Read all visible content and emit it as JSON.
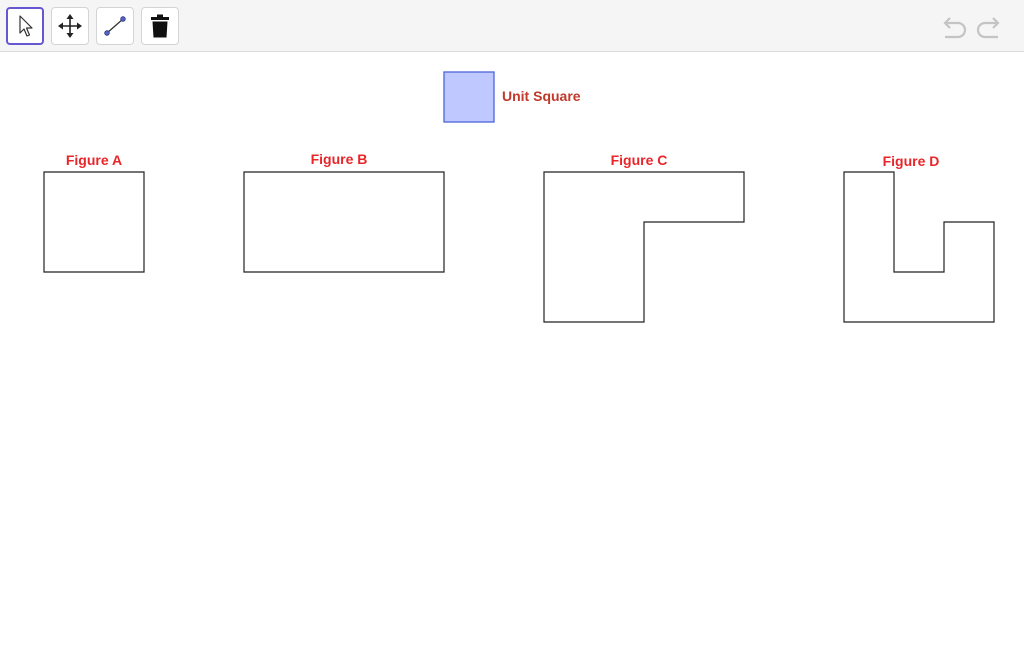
{
  "toolbar": {
    "tools": [
      {
        "name": "move-tool",
        "icon": "arrow-cursor-icon",
        "selected": true
      },
      {
        "name": "move-graphics-view-tool",
        "icon": "four-way-arrows-icon",
        "selected": false
      },
      {
        "name": "segment-tool",
        "icon": "segment-icon",
        "selected": false
      },
      {
        "name": "delete-tool",
        "icon": "trash-icon",
        "selected": false
      }
    ],
    "undo_icon": "undo-icon",
    "redo_icon": "redo-icon"
  },
  "canvas": {
    "unit_square": {
      "label": "Unit Square",
      "fill": "#c0c9ff",
      "stroke": "#4a64d8"
    },
    "figures": [
      {
        "label": "Figure A"
      },
      {
        "label": "Figure B"
      },
      {
        "label": "Figure C"
      },
      {
        "label": "Figure D"
      }
    ]
  },
  "colors": {
    "selected_tool_border": "#6557d2",
    "label_red": "#e8262a",
    "unit_label": "#c0392b"
  }
}
